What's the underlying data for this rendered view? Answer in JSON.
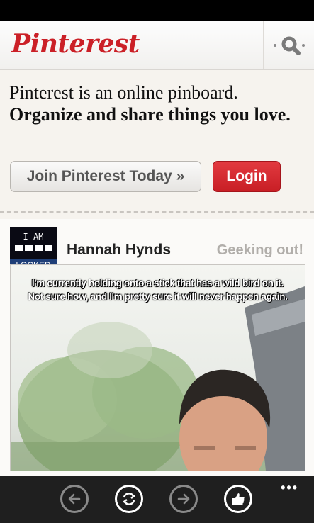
{
  "header": {
    "logo_text": "Pinterest",
    "search_icon": "search-icon"
  },
  "hero": {
    "line1": "Pinterest is an online pinboard.",
    "line2": "Organize and share things you love.",
    "join_label": "Join Pinterest Today »",
    "login_label": "Login"
  },
  "pin": {
    "avatar": {
      "line1": "I AM",
      "line2": "LOCKED"
    },
    "username": "Hannah Hynds",
    "board": "Geeking out!",
    "caption_line1": "I'm currently holding onto a stick that has a wild bird on it.",
    "caption_line2": "Not sure how, and I'm pretty sure it will never happen again."
  },
  "appbar": {
    "buttons": [
      {
        "icon": "back-icon",
        "enabled": false
      },
      {
        "icon": "refresh-icon",
        "enabled": true
      },
      {
        "icon": "forward-icon",
        "enabled": false
      },
      {
        "icon": "like-icon",
        "enabled": true
      }
    ],
    "more_icon": "ellipsis-icon"
  },
  "colors": {
    "brand_red": "#cb2027",
    "appbar_bg": "#1f1f1f"
  }
}
